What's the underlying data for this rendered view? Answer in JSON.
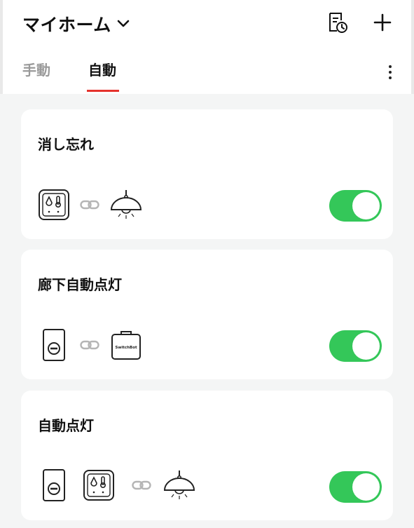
{
  "header": {
    "home_title": "マイホーム",
    "tabs": [
      {
        "label": "手動",
        "active": false
      },
      {
        "label": "自動",
        "active": true
      }
    ]
  },
  "scenes": [
    {
      "title": "消し忘れ",
      "enabled": true,
      "trigger_devices": [
        "meter-icon"
      ],
      "action_devices": [
        "ceiling-light-icon"
      ]
    },
    {
      "title": "廊下自動点灯",
      "enabled": true,
      "trigger_devices": [
        "motion-sensor-icon"
      ],
      "action_devices": [
        "hub-icon"
      ],
      "hub_label": "SwitchBot"
    },
    {
      "title": "自動点灯",
      "enabled": true,
      "trigger_devices": [
        "motion-sensor-icon",
        "meter-icon"
      ],
      "action_devices": [
        "ceiling-light-icon"
      ]
    }
  ],
  "colors": {
    "accent": "#e5322d",
    "toggle_on": "#34c759",
    "background": "#f4f5f5"
  }
}
